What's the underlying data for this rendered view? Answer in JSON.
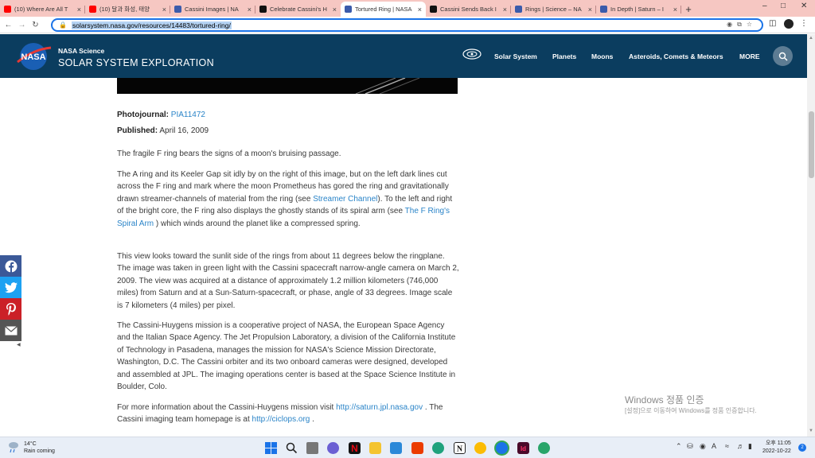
{
  "browser": {
    "tabs": [
      {
        "title": "(10) Where Are All T",
        "color": "#ff0000"
      },
      {
        "title": "(10) 달과 화성, 태양",
        "color": "#ff0000"
      },
      {
        "title": "Cassini Images | NA",
        "color": "#3b5bab"
      },
      {
        "title": "Celebrate Cassini's H",
        "color": "#111111"
      },
      {
        "title": "Tortured Ring | NASA",
        "color": "#3b5bab"
      },
      {
        "title": "Cassini Sends Back I",
        "color": "#111111"
      },
      {
        "title": "Rings | Science – NA",
        "color": "#3b5bab"
      },
      {
        "title": "In Depth | Saturn – I",
        "color": "#3b5bab"
      }
    ],
    "new_tab": "+",
    "url": "solarsystem.nasa.gov/resources/14483/tortured-ring/"
  },
  "site": {
    "brand_small": "NASA Science",
    "brand_big": "SOLAR SYSTEM EXPLORATION",
    "logo_text": "NASA",
    "nav": [
      "Solar System",
      "Planets",
      "Moons",
      "Asteroids, Comets & Meteors",
      "MORE"
    ]
  },
  "article": {
    "photojournal_label": "Photojournal:",
    "photojournal_id": "PIA11472",
    "published_label": "Published:",
    "published_date": "April 16, 2009",
    "p1": "The fragile F ring bears the signs of a moon's bruising passage.",
    "p2a": "The A ring and its Keeler Gap sit idly by on the right of this image, but on the left dark lines cut across the F ring and mark where the moon Prometheus has gored the ring and gravitationally drawn streamer-channels of material from the ring (see ",
    "p2_link1": "Streamer Channel",
    "p2b": "). To the left and right of the bright core, the F ring also displays the ghostly stands of its spiral arm (see ",
    "p2_link2": "The F Ring's Spiral Arm",
    "p2c": " ) which winds around the planet like a compressed spring.",
    "p3": "This view looks toward the sunlit side of the rings from about 11 degrees below the ringplane. The image was taken in green light with the Cassini spacecraft narrow-angle camera on March 2, 2009. The view was acquired at a distance of approximately 1.2 million kilometers (746,000 miles) from Saturn and at a Sun-Saturn-spacecraft, or phase, angle of 33 degrees. Image scale is 7 kilometers (4 miles) per pixel.",
    "p4": "The Cassini-Huygens mission is a cooperative project of NASA, the European Space Agency and the Italian Space Agency. The Jet Propulsion Laboratory, a division of the California Institute of Technology in Pasadena, manages the mission for NASA's Science Mission Directorate, Washington, D.C. The Cassini orbiter and its two onboard cameras were designed, developed and assembled at JPL. The imaging operations center is based at the Space Science Institute in Boulder, Colo.",
    "p5a": "For more information about the Cassini-Huygens mission visit ",
    "p5_link1": "http://saturn.jpl.nasa.gov",
    "p5b": " . The Cassini imaging team homepage is at ",
    "p5_link2": "http://ciclops.org",
    "p5c": " ."
  },
  "watermark": {
    "line1": "Windows 정품 인증",
    "line2": "[설정]으로 이동하여 Windows를 정품 인증합니다."
  },
  "taskbar": {
    "temp": "14°C",
    "condition": "Rain coming",
    "ime": "A",
    "time": "오후 11:05",
    "date": "2022-10-22",
    "notif_count": "2"
  }
}
